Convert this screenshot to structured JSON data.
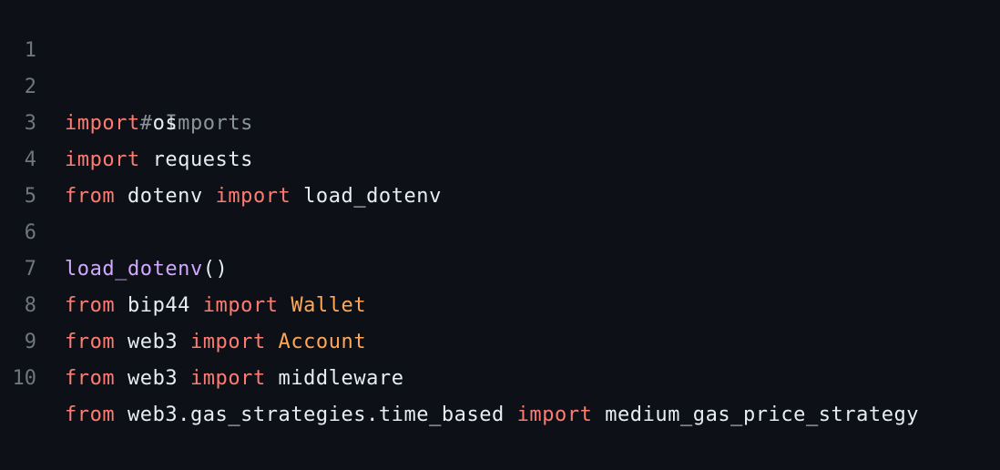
{
  "editor": {
    "language": "python",
    "colors": {
      "background": "#0d1117",
      "line_number": "#6e7681",
      "keyword": "#ff7b72",
      "class": "#ffa657",
      "function": "#d2a8ff",
      "comment": "#8b949e",
      "plain": "#e6edf3"
    },
    "lines": [
      {
        "number": "1",
        "tokens": [
          {
            "text": "# Imports",
            "type": "cm"
          }
        ]
      },
      {
        "number": "2",
        "tokens": [
          {
            "text": "import",
            "type": "kw"
          },
          {
            "text": " os",
            "type": "pl"
          }
        ]
      },
      {
        "number": "3",
        "tokens": [
          {
            "text": "import",
            "type": "kw"
          },
          {
            "text": " requests",
            "type": "pl"
          }
        ]
      },
      {
        "number": "4",
        "tokens": [
          {
            "text": "from",
            "type": "kw"
          },
          {
            "text": " dotenv ",
            "type": "pl"
          },
          {
            "text": "import",
            "type": "kw"
          },
          {
            "text": " load_dotenv",
            "type": "pl"
          }
        ]
      },
      {
        "number": "5",
        "tokens": []
      },
      {
        "number": "6",
        "tokens": [
          {
            "text": "load_dotenv",
            "type": "fn"
          },
          {
            "text": "()",
            "type": "pl"
          }
        ]
      },
      {
        "number": "7",
        "tokens": [
          {
            "text": "from",
            "type": "kw"
          },
          {
            "text": " bip44 ",
            "type": "pl"
          },
          {
            "text": "import",
            "type": "kw"
          },
          {
            "text": " ",
            "type": "pl"
          },
          {
            "text": "Wallet",
            "type": "cls"
          }
        ]
      },
      {
        "number": "8",
        "tokens": [
          {
            "text": "from",
            "type": "kw"
          },
          {
            "text": " web3 ",
            "type": "pl"
          },
          {
            "text": "import",
            "type": "kw"
          },
          {
            "text": " ",
            "type": "pl"
          },
          {
            "text": "Account",
            "type": "cls"
          }
        ]
      },
      {
        "number": "9",
        "tokens": [
          {
            "text": "from",
            "type": "kw"
          },
          {
            "text": " web3 ",
            "type": "pl"
          },
          {
            "text": "import",
            "type": "kw"
          },
          {
            "text": " middleware",
            "type": "pl"
          }
        ]
      },
      {
        "number": "10",
        "tokens": [
          {
            "text": "from",
            "type": "kw"
          },
          {
            "text": " web3.gas_strategies.time_based ",
            "type": "pl"
          },
          {
            "text": "import",
            "type": "kw"
          },
          {
            "text": " medium_gas_price_strategy",
            "type": "pl"
          }
        ]
      }
    ]
  }
}
